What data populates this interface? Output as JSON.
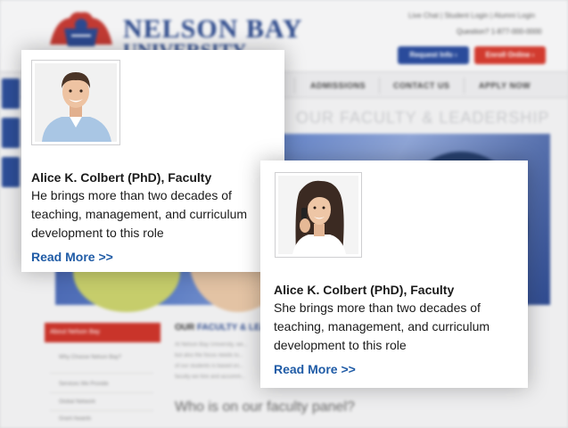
{
  "background_site": {
    "logo_text": "NELSON BAY",
    "logo_subtext": "UNIVERSITY",
    "top_links": "Live Chat | Student Login | Alumni Login",
    "phone": "Question? 1-877-000-0000",
    "request_info_label": "Request Info ›",
    "enroll_label": "Enroll Online ›",
    "nav": [
      "ADMISSIONS",
      "CONTACT US",
      "APPLY NOW"
    ],
    "page_heading": "OUR FACULTY & LEADERSHIP",
    "sidebar_title": "About Nelson Bay",
    "sidebar_items": [
      "Why Choose Nelson Bay?",
      "Services We Provide",
      "Global Network",
      "Grant Awards"
    ],
    "section_title_prefix": "OUR ",
    "section_title_main": "FACULTY & LEADERSHIP",
    "intro_lines": [
      "At Nelson Bay University, we...",
      "but also the focus needs to...",
      "of our students is based on...",
      "faculty we hire and accomm..."
    ],
    "subheading": "Who is on our faculty panel?"
  },
  "cards": [
    {
      "name": "Alice K. Colbert (PhD), Faculty",
      "bio": "He brings more than two decades of teaching, management, and curriculum development to this role",
      "link_label": "Read More >>",
      "photo": "male-faculty-portrait"
    },
    {
      "name": "Alice K. Colbert (PhD), Faculty",
      "bio": "She brings more than two decades of teaching, management, and curriculum development to this role",
      "link_label": "Read More >>",
      "photo": "female-faculty-portrait-on-phone"
    }
  ],
  "colors": {
    "brand_blue": "#2d4a8c",
    "brand_red": "#c9342a",
    "link_blue": "#1f5ba6"
  }
}
